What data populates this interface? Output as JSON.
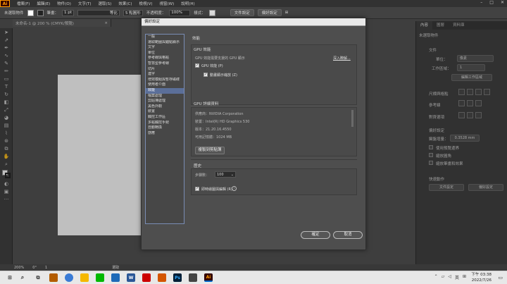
{
  "app": {
    "logo": "Ai",
    "menus": [
      "檔案(F)",
      "編輯(E)",
      "物件(O)",
      "文字(T)",
      "選取(S)",
      "效果(C)",
      "檢視(V)",
      "視窗(W)",
      "說明(H)"
    ]
  },
  "control_bar": {
    "selection_label": "未選取物件",
    "stroke_label": "筆畫：",
    "stroke_value": "1 pt",
    "brush_label": "等比",
    "point_round": "5 點圓形",
    "opacity_label": "不透明度：",
    "opacity_value": "100%",
    "style_label": "樣式：",
    "doc_setup": "文件設定",
    "prefs": "偏好設定"
  },
  "document_tab": {
    "title": "未命名-1 @ 200 % (CMYK/預覽)",
    "close": "×"
  },
  "dialog": {
    "title": "偏好設定",
    "categories": [
      "一般",
      "選取範圍與錨點顯示",
      "文字",
      "單位",
      "參考線與格點",
      "智慧型參考線",
      "切片",
      "連字",
      "增效模組與暫存磁碟",
      "使用者介面",
      "效能",
      "檔案處理",
      "剪貼簿處理",
      "黑色外觀",
      "裝置",
      "觸控工作區",
      "多點觸控手勢",
      "自動轉換",
      "感應"
    ],
    "selected_index": 10,
    "section_title": "效能",
    "gpu_title": "GPU 效能",
    "gpu_hint": "GPU 效能需要支援的 GPU 顯示",
    "gpu_more": "深入瞭解...",
    "gpu_checkbox": "GPU 效能 (P)",
    "gpu_checked": true,
    "anim_checkbox": "動畫顯示縮放 (Z)",
    "anim_checked": true,
    "gpu_detail_title": "GPU 詳細資料",
    "vendor": "供應商：NVIDIA Corporation",
    "device": "裝置：Intel(R) HD Graphics 530",
    "version": "版本：21.20.16.4550",
    "memory": "可用記憶體：1024 MB",
    "copy_button": "複製到剪貼簿",
    "history_title": "歷史",
    "history_label": "步驟數：",
    "history_value": "100",
    "realtime_checkbox": "即時繪圖與編輯 (R)",
    "realtime_checked": true,
    "ok": "確定",
    "cancel": "取消"
  },
  "right_panel": {
    "tabs": [
      "內容",
      "圖層",
      "資料庫"
    ],
    "doc_label": "文件",
    "units_label": "單位：",
    "units_value": "像素",
    "artboard_label": "工作區域：",
    "artboard_value": "1",
    "edit_artboard": "編輯工作區域",
    "ruler_label": "尺標與格點",
    "guides_label": "參考線",
    "snap_label": "對齊選項",
    "prefs_label": "偏好設定",
    "keyboard_inc_label": "鍵盤增量：",
    "keyboard_inc_value": "0.3528 mm",
    "chk1": "使用預覽邊界",
    "chk2": "縮放圓角",
    "chk3": "縮放筆畫和效果",
    "quick_label": "快速動作",
    "doc_setup": "文件設定",
    "prefs_btn": "偏好設定"
  },
  "status": {
    "zoom": "200%",
    "angle": "0°",
    "page": "1",
    "tool": "選取"
  },
  "taskbar": {
    "lang": "英",
    "time": "下午 03:38",
    "date": "2022/7/26"
  }
}
